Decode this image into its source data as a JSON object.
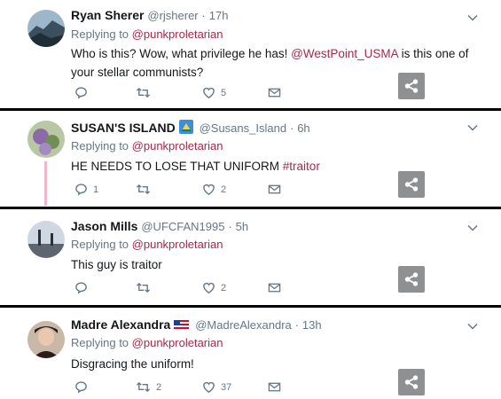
{
  "tweets": [
    {
      "name": "Ryan Sherer",
      "handle": "@rjsherer",
      "sep": "·",
      "time": "17h",
      "reply_prefix": "Replying to",
      "reply_to": "@punkproletarian",
      "text_before": "Who is this?  Wow, what privilege he has! ",
      "mention": "@WestPoint_USMA",
      "text_after": " is this one of your stellar communists?",
      "likes": "5"
    },
    {
      "name": "SUSAN'S ISLAND",
      "handle": "@Susans_Island",
      "sep": "·",
      "time": "6h",
      "reply_prefix": "Replying to",
      "reply_to": "@punkproletarian",
      "text_before": "HE NEEDS TO LOSE THAT UNIFORM ",
      "hashtag": "#traitor",
      "replies": "1",
      "likes": "2"
    },
    {
      "name": "Jason Mills",
      "handle": "@UFCFAN1995",
      "sep": "·",
      "time": "5h",
      "reply_prefix": "Replying to",
      "reply_to": "@punkproletarian",
      "text": "This guy is traitor",
      "likes": "2"
    },
    {
      "name": "Madre Alexandra",
      "handle": "@MadreAlexandra",
      "sep": "·",
      "time": "13h",
      "reply_prefix": "Replying to",
      "reply_to": "@punkproletarian",
      "text": "Disgracing the uniform!",
      "retweets": "2",
      "likes": "37"
    }
  ],
  "icons": {
    "reply": "reply-icon",
    "retweet": "retweet-icon",
    "like": "heart-icon",
    "dm": "envelope-icon",
    "share": "share-icon",
    "menu": "chevron-down-icon"
  },
  "colors": {
    "link": "#a52a4a",
    "muted": "#657786",
    "share_bg": "#8e9092",
    "thread_line": "#f0b7c7"
  }
}
